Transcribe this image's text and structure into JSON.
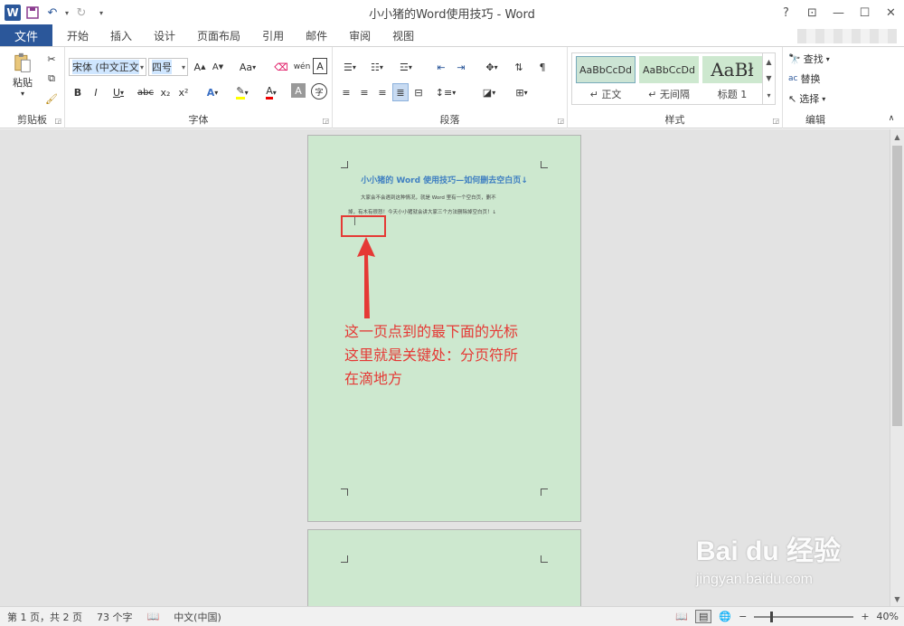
{
  "window": {
    "title": "小小猪的Word使用技巧 - Word",
    "help": "?",
    "ribbon_display": "⊡",
    "minimize": "—",
    "maximize": "☐",
    "close": "✕"
  },
  "qat": {
    "logo": "W"
  },
  "tabs": {
    "file": "文件",
    "items": [
      "开始",
      "插入",
      "设计",
      "页面布局",
      "引用",
      "邮件",
      "审阅",
      "视图"
    ],
    "active": "开始"
  },
  "ribbon": {
    "clipboard": {
      "label": "剪贴板",
      "paste": "粘贴"
    },
    "font": {
      "label": "字体",
      "font_name": "宋体 (中文正文",
      "font_size": "四号",
      "bold": "B",
      "italic": "I",
      "underline": "U",
      "strike": "abc",
      "sub": "x₂",
      "sup": "x²",
      "aa": "Aa",
      "grow": "A",
      "shrink": "A",
      "font_color": "A",
      "highlight": "A",
      "wen": "wén",
      "border_char": "A",
      "circle_char": "字"
    },
    "paragraph": {
      "label": "段落"
    },
    "styles": {
      "label": "样式",
      "items": [
        {
          "sample": "AaBbCcDd",
          "name": "↵ 正文"
        },
        {
          "sample": "AaBbCcDd",
          "name": "↵ 无间隔"
        },
        {
          "sample": "AaBł",
          "name": "标题 1"
        }
      ]
    },
    "editing": {
      "label": "编辑",
      "find": "查找",
      "replace": "替换",
      "select": "选择"
    }
  },
  "document": {
    "heading": "小小猪的 Word 使用技巧—如何删去空白页↓",
    "line1": "大家会不会遇到这种情况，就是 Word 里有一个空白页，删不",
    "line2": "掉，有木有很怒！今天小小猪就会讲大家三个方法删除掉空白页！↓",
    "cursor": "|",
    "annotation": [
      "这一页点到的最下面的光标",
      "这里就是关键处：分页符所",
      "在滴地方"
    ]
  },
  "status": {
    "page": "第 1 页，共 2 页",
    "words": "73 个字",
    "language": "中文(中国)",
    "zoom": "40%",
    "zoom_level": 0.4,
    "zoom_out": "−",
    "zoom_in": "+"
  },
  "watermark": {
    "logo": "Bai du 经验",
    "url": "jingyan.baidu.com"
  }
}
